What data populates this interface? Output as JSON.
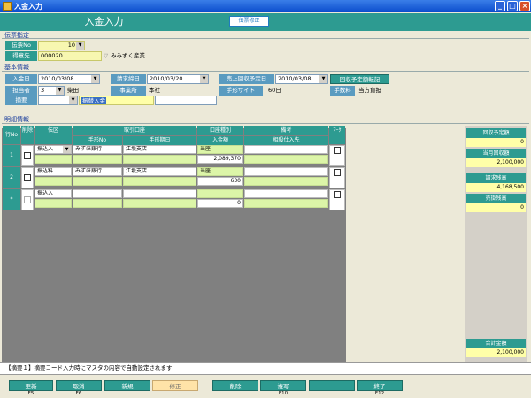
{
  "window": {
    "title": "入金入力"
  },
  "header": {
    "title": "入金入力",
    "mode_button": "伝票修正"
  },
  "voucher": {
    "section": "伝票指定",
    "no_label": "伝票No",
    "no_value": "10",
    "customer_label": "得意先",
    "customer_code": "000020",
    "customer_name": "みみずく産業"
  },
  "basic": {
    "section": "基本情報",
    "deposit_date_label": "入金日",
    "deposit_date": "2010/03/08",
    "billing_close_label": "請求締日",
    "billing_close": "2010/03/20",
    "ar_date_label": "売上回収予定日",
    "ar_date": "2010/03/08",
    "ar_button": "回収予定額転記",
    "staff_label": "担当者",
    "staff_code": "3",
    "staff_name": "柴田",
    "office_label": "事業所",
    "office_value": "本社",
    "site_label": "手形サイト",
    "site_value": "60日",
    "fee_label": "手数料",
    "fee_value": "当方負担",
    "summary_label": "摘要",
    "summary_value": "振替入金"
  },
  "detail": {
    "section": "明細情報",
    "headers": {
      "row": "行No",
      "delete": "削除",
      "type": "伝区",
      "account": "取引口座",
      "bill_no": "手形No",
      "bill_due": "手形期日",
      "acct_type": "口座種別",
      "amount": "入金額",
      "remark": "備考",
      "offset": "相殺仕入先",
      "mark": "ﾏｰｸ"
    },
    "rows": [
      {
        "no": "1",
        "type": "振込入",
        "bank": "みずほ銀行",
        "branch": "江坂支店",
        "acct_type": "当座",
        "amount": "2,089,370"
      },
      {
        "no": "2",
        "type": "振込料",
        "bank": "みずほ銀行",
        "branch": "江坂支店",
        "acct_type": "当座",
        "amount": "630"
      },
      {
        "no": "*",
        "type": "振込入",
        "bank": "",
        "branch": "",
        "acct_type": "",
        "amount": "0"
      }
    ]
  },
  "side": {
    "scheduled_label": "回収予定額",
    "scheduled_value": "0",
    "month_label": "当月回収額",
    "month_value": "2,100,000",
    "billing_label": "請求残高",
    "billing_value": "4,168,500",
    "sales_label": "売掛残高",
    "sales_value": "0",
    "total_label": "合計金額",
    "total_value": "2,100,000"
  },
  "status": {
    "message": "【摘要１】摘要コード入力時にマスタの内容で自動設定されます"
  },
  "fkeys": [
    {
      "label": "更新",
      "key": "F5"
    },
    {
      "label": "取消",
      "key": "F6"
    },
    {
      "label": "新規",
      "key": ""
    },
    {
      "label": "修正",
      "key": ""
    },
    {
      "label": "削除",
      "key": ""
    },
    {
      "label": "複写",
      "key": "F10"
    },
    {
      "label": "",
      "key": ""
    },
    {
      "label": "終了",
      "key": "F12"
    }
  ]
}
